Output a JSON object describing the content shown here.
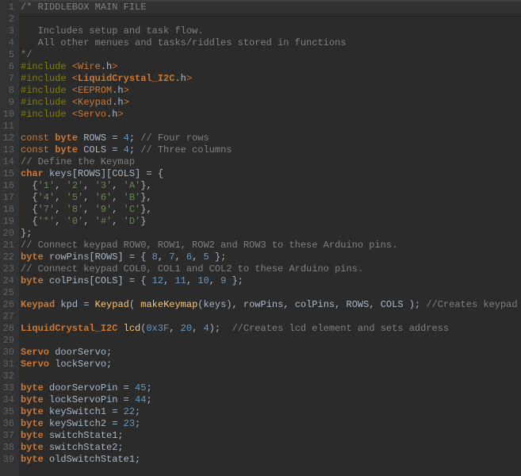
{
  "editor": {
    "first_line": 1,
    "lines": [
      [
        [
          "c-comment",
          "/* RIDDLEBOX MAIN FILE"
        ]
      ],
      [],
      [
        [
          "c-comment",
          "   Includes setup and task flow."
        ]
      ],
      [
        [
          "c-comment",
          "   All other menues and tasks/riddles stored in functions"
        ]
      ],
      [
        [
          "c-comment",
          "*/"
        ]
      ],
      [
        [
          "c-preproc",
          "#include "
        ],
        [
          "c-include",
          "<"
        ],
        [
          "c-include",
          "Wire"
        ],
        [
          "c-text",
          ".h"
        ],
        [
          "c-include",
          ">"
        ]
      ],
      [
        [
          "c-preproc",
          "#include "
        ],
        [
          "c-include",
          "<"
        ],
        [
          "c-class",
          "LiquidCrystal_I2C"
        ],
        [
          "c-text",
          ".h"
        ],
        [
          "c-include",
          ">"
        ]
      ],
      [
        [
          "c-preproc",
          "#include "
        ],
        [
          "c-include",
          "<"
        ],
        [
          "c-include",
          "EEPROM"
        ],
        [
          "c-text",
          ".h"
        ],
        [
          "c-include",
          ">"
        ]
      ],
      [
        [
          "c-preproc",
          "#include "
        ],
        [
          "c-include",
          "<"
        ],
        [
          "c-include",
          "Keypad"
        ],
        [
          "c-text",
          ".h"
        ],
        [
          "c-include",
          ">"
        ]
      ],
      [
        [
          "c-preproc",
          "#include "
        ],
        [
          "c-include",
          "<"
        ],
        [
          "c-include",
          "Servo"
        ],
        [
          "c-text",
          ".h"
        ],
        [
          "c-include",
          ">"
        ]
      ],
      [],
      [
        [
          "c-keyword",
          "const "
        ],
        [
          "c-type",
          "byte"
        ],
        [
          "c-text",
          " ROWS = "
        ],
        [
          "c-number",
          "4"
        ],
        [
          "c-text",
          "; "
        ],
        [
          "c-comment",
          "// Four rows"
        ]
      ],
      [
        [
          "c-keyword",
          "const "
        ],
        [
          "c-type",
          "byte"
        ],
        [
          "c-text",
          " COLS = "
        ],
        [
          "c-number",
          "4"
        ],
        [
          "c-text",
          "; "
        ],
        [
          "c-comment",
          "// Three columns"
        ]
      ],
      [
        [
          "c-comment",
          "// Define the Keymap"
        ]
      ],
      [
        [
          "c-type",
          "char"
        ],
        [
          "c-text",
          " keys[ROWS][COLS] = {"
        ]
      ],
      [
        [
          "c-text",
          "  {"
        ],
        [
          "c-char",
          "'1'"
        ],
        [
          "c-text",
          ", "
        ],
        [
          "c-char",
          "'2'"
        ],
        [
          "c-text",
          ", "
        ],
        [
          "c-char",
          "'3'"
        ],
        [
          "c-text",
          ", "
        ],
        [
          "c-char",
          "'A'"
        ],
        [
          "c-text",
          "},"
        ]
      ],
      [
        [
          "c-text",
          "  {"
        ],
        [
          "c-char",
          "'4'"
        ],
        [
          "c-text",
          ", "
        ],
        [
          "c-char",
          "'5'"
        ],
        [
          "c-text",
          ", "
        ],
        [
          "c-char",
          "'6'"
        ],
        [
          "c-text",
          ", "
        ],
        [
          "c-char",
          "'B'"
        ],
        [
          "c-text",
          "},"
        ]
      ],
      [
        [
          "c-text",
          "  {"
        ],
        [
          "c-char",
          "'7'"
        ],
        [
          "c-text",
          ", "
        ],
        [
          "c-char",
          "'8'"
        ],
        [
          "c-text",
          ", "
        ],
        [
          "c-char",
          "'9'"
        ],
        [
          "c-text",
          ", "
        ],
        [
          "c-char",
          "'C'"
        ],
        [
          "c-text",
          "},"
        ]
      ],
      [
        [
          "c-text",
          "  {"
        ],
        [
          "c-char",
          "'*'"
        ],
        [
          "c-text",
          ", "
        ],
        [
          "c-char",
          "'0'"
        ],
        [
          "c-text",
          ", "
        ],
        [
          "c-char",
          "'#'"
        ],
        [
          "c-text",
          ", "
        ],
        [
          "c-char",
          "'D'"
        ],
        [
          "c-text",
          "}"
        ]
      ],
      [
        [
          "c-text",
          "};"
        ]
      ],
      [
        [
          "c-comment",
          "// Connect keypad ROW0, ROW1, ROW2 and ROW3 to these Arduino pins."
        ]
      ],
      [
        [
          "c-type",
          "byte"
        ],
        [
          "c-text",
          " rowPins[ROWS] = { "
        ],
        [
          "c-number",
          "8"
        ],
        [
          "c-text",
          ", "
        ],
        [
          "c-number",
          "7"
        ],
        [
          "c-text",
          ", "
        ],
        [
          "c-number",
          "6"
        ],
        [
          "c-text",
          ", "
        ],
        [
          "c-number",
          "5"
        ],
        [
          "c-text",
          " };"
        ]
      ],
      [
        [
          "c-comment",
          "// Connect keypad COL0, COL1 and COL2 to these Arduino pins."
        ]
      ],
      [
        [
          "c-type",
          "byte"
        ],
        [
          "c-text",
          " colPins[COLS] = { "
        ],
        [
          "c-number",
          "12"
        ],
        [
          "c-text",
          ", "
        ],
        [
          "c-number",
          "11"
        ],
        [
          "c-text",
          ", "
        ],
        [
          "c-number",
          "10"
        ],
        [
          "c-text",
          ", "
        ],
        [
          "c-number",
          "9"
        ],
        [
          "c-text",
          " };"
        ]
      ],
      [],
      [
        [
          "c-class",
          "Keypad"
        ],
        [
          "c-text",
          " kpd = "
        ],
        [
          "c-func",
          "Keypad"
        ],
        [
          "c-text",
          "( "
        ],
        [
          "c-func",
          "makeKeymap"
        ],
        [
          "c-text",
          "(keys), rowPins, colPins, ROWS, COLS ); "
        ],
        [
          "c-comment",
          "//Creates keypad element"
        ]
      ],
      [],
      [
        [
          "c-class",
          "LiquidCrystal_I2C"
        ],
        [
          "c-text",
          " "
        ],
        [
          "c-func",
          "lcd"
        ],
        [
          "c-text",
          "("
        ],
        [
          "c-hexnum",
          "0x3F"
        ],
        [
          "c-text",
          ", "
        ],
        [
          "c-number",
          "20"
        ],
        [
          "c-text",
          ", "
        ],
        [
          "c-number",
          "4"
        ],
        [
          "c-text",
          ");  "
        ],
        [
          "c-comment",
          "//Creates lcd element and sets address"
        ]
      ],
      [],
      [
        [
          "c-class",
          "Servo"
        ],
        [
          "c-text",
          " doorServo;"
        ]
      ],
      [
        [
          "c-class",
          "Servo"
        ],
        [
          "c-text",
          " lockServo;"
        ]
      ],
      [],
      [
        [
          "c-type",
          "byte"
        ],
        [
          "c-text",
          " doorServoPin = "
        ],
        [
          "c-number",
          "45"
        ],
        [
          "c-text",
          ";"
        ]
      ],
      [
        [
          "c-type",
          "byte"
        ],
        [
          "c-text",
          " lockServoPin = "
        ],
        [
          "c-number",
          "44"
        ],
        [
          "c-text",
          ";"
        ]
      ],
      [
        [
          "c-type",
          "byte"
        ],
        [
          "c-text",
          " keySwitch1 = "
        ],
        [
          "c-number",
          "22"
        ],
        [
          "c-text",
          ";"
        ]
      ],
      [
        [
          "c-type",
          "byte"
        ],
        [
          "c-text",
          " keySwitch2 = "
        ],
        [
          "c-number",
          "23"
        ],
        [
          "c-text",
          ";"
        ]
      ],
      [
        [
          "c-type",
          "byte"
        ],
        [
          "c-text",
          " switchState1;"
        ]
      ],
      [
        [
          "c-type",
          "byte"
        ],
        [
          "c-text",
          " switchState2;"
        ]
      ],
      [
        [
          "c-type",
          "byte"
        ],
        [
          "c-text",
          " oldSwitchState1;"
        ]
      ]
    ]
  }
}
